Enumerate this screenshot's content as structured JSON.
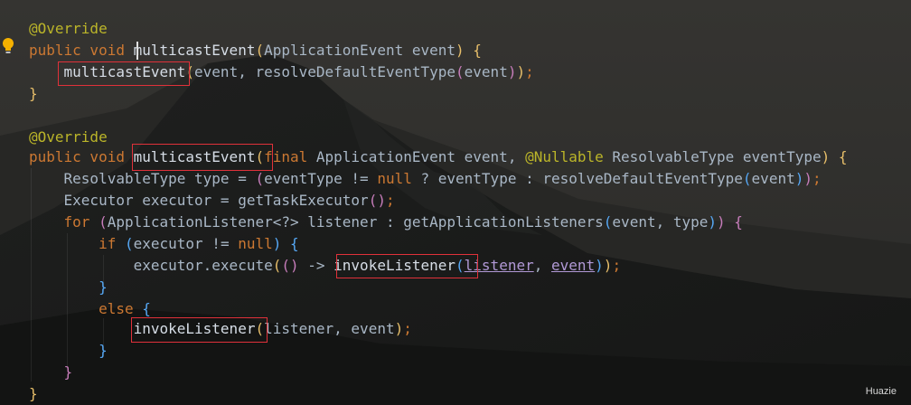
{
  "editor": {
    "watermark": "Huazie",
    "theme_colors": {
      "keyword": "#cc7832",
      "annotation": "#bbb529",
      "text": "#a9b7c6",
      "parameter": "#b199d6",
      "highlight_box": "#e0313a"
    },
    "gutter_icon": "lightbulb-icon",
    "lines": [
      {
        "id": 1,
        "segments": [
          {
            "t": "@Override",
            "c": "ann"
          }
        ]
      },
      {
        "id": 2,
        "segments": [
          {
            "t": "public void ",
            "c": "kw"
          },
          {
            "t": "multicastEvent",
            "c": "mcall"
          },
          {
            "t": "(",
            "c": "p1"
          },
          {
            "t": "ApplicationEvent event",
            "c": ""
          },
          {
            "t": ")",
            "c": "p1"
          },
          {
            "t": " {",
            "c": "p1"
          }
        ]
      },
      {
        "id": 3,
        "segments": [
          {
            "t": "    multicastEvent",
            "c": "mcall"
          },
          {
            "t": "(",
            "c": "p1"
          },
          {
            "t": "event, resolveDefaultEventType",
            "c": ""
          },
          {
            "t": "(",
            "c": "p2"
          },
          {
            "t": "event",
            "c": ""
          },
          {
            "t": ")",
            "c": "p2"
          },
          {
            "t": ")",
            "c": "p1"
          },
          {
            "t": ";",
            "c": "kw"
          }
        ]
      },
      {
        "id": 4,
        "segments": [
          {
            "t": "}",
            "c": "p1"
          }
        ]
      },
      {
        "id": 5,
        "segments": []
      },
      {
        "id": 6,
        "segments": [
          {
            "t": "@Override",
            "c": "ann"
          }
        ]
      },
      {
        "id": 7,
        "segments": [
          {
            "t": "public void ",
            "c": "kw"
          },
          {
            "t": "multicastEvent",
            "c": "mcall"
          },
          {
            "t": "(",
            "c": "p1"
          },
          {
            "t": "final ",
            "c": "kw"
          },
          {
            "t": "ApplicationEvent event, ",
            "c": ""
          },
          {
            "t": "@Nullable ",
            "c": "ann"
          },
          {
            "t": "ResolvableType eventType",
            "c": ""
          },
          {
            "t": ")",
            "c": "p1"
          },
          {
            "t": " {",
            "c": "p1"
          }
        ]
      },
      {
        "id": 8,
        "segments": [
          {
            "t": "    ResolvableType type = ",
            "c": ""
          },
          {
            "t": "(",
            "c": "p2"
          },
          {
            "t": "eventType != ",
            "c": ""
          },
          {
            "t": "null",
            "c": "kw"
          },
          {
            "t": " ? eventType : resolveDefaultEventType",
            "c": ""
          },
          {
            "t": "(",
            "c": "p3"
          },
          {
            "t": "event",
            "c": ""
          },
          {
            "t": ")",
            "c": "p3"
          },
          {
            "t": ")",
            "c": "p2"
          },
          {
            "t": ";",
            "c": "kw"
          }
        ]
      },
      {
        "id": 9,
        "segments": [
          {
            "t": "    Executor executor = getTaskExecutor",
            "c": ""
          },
          {
            "t": "()",
            "c": "p2"
          },
          {
            "t": ";",
            "c": "kw"
          }
        ]
      },
      {
        "id": 10,
        "segments": [
          {
            "t": "    for ",
            "c": "kw"
          },
          {
            "t": "(",
            "c": "p2"
          },
          {
            "t": "ApplicationListener<?> listener : getApplicationListeners",
            "c": ""
          },
          {
            "t": "(",
            "c": "p3"
          },
          {
            "t": "event, type",
            "c": ""
          },
          {
            "t": ")",
            "c": "p3"
          },
          {
            "t": ")",
            "c": "p2"
          },
          {
            "t": " {",
            "c": "p2"
          }
        ]
      },
      {
        "id": 11,
        "segments": [
          {
            "t": "        if ",
            "c": "kw"
          },
          {
            "t": "(",
            "c": "p3"
          },
          {
            "t": "executor != ",
            "c": ""
          },
          {
            "t": "null",
            "c": "kw"
          },
          {
            "t": ")",
            "c": "p3"
          },
          {
            "t": " {",
            "c": "p3"
          }
        ]
      },
      {
        "id": 12,
        "segments": [
          {
            "t": "            executor.execute",
            "c": ""
          },
          {
            "t": "(",
            "c": "p1"
          },
          {
            "t": "()",
            "c": "p2"
          },
          {
            "t": " -> ",
            "c": ""
          },
          {
            "t": "invokeListener",
            "c": "mcall"
          },
          {
            "t": "(",
            "c": "p3"
          },
          {
            "t": "listener",
            "c": "param"
          },
          {
            "t": ", ",
            "c": ""
          },
          {
            "t": "event",
            "c": "param"
          },
          {
            "t": ")",
            "c": "p3"
          },
          {
            "t": ")",
            "c": "p1"
          },
          {
            "t": ";",
            "c": "kw"
          }
        ]
      },
      {
        "id": 13,
        "segments": [
          {
            "t": "        }",
            "c": "p3"
          }
        ]
      },
      {
        "id": 14,
        "segments": [
          {
            "t": "        else ",
            "c": "kw"
          },
          {
            "t": "{",
            "c": "p3"
          }
        ]
      },
      {
        "id": 15,
        "segments": [
          {
            "t": "            invokeListener",
            "c": "mcall"
          },
          {
            "t": "(",
            "c": "p1"
          },
          {
            "t": "listener, event",
            "c": ""
          },
          {
            "t": ")",
            "c": "p1"
          },
          {
            "t": ";",
            "c": "kw"
          }
        ]
      },
      {
        "id": 16,
        "segments": [
          {
            "t": "        }",
            "c": "p3"
          }
        ]
      },
      {
        "id": 17,
        "segments": [
          {
            "t": "    }",
            "c": "p2"
          }
        ]
      },
      {
        "id": 18,
        "segments": [
          {
            "t": "}",
            "c": "p1"
          }
        ]
      }
    ]
  }
}
